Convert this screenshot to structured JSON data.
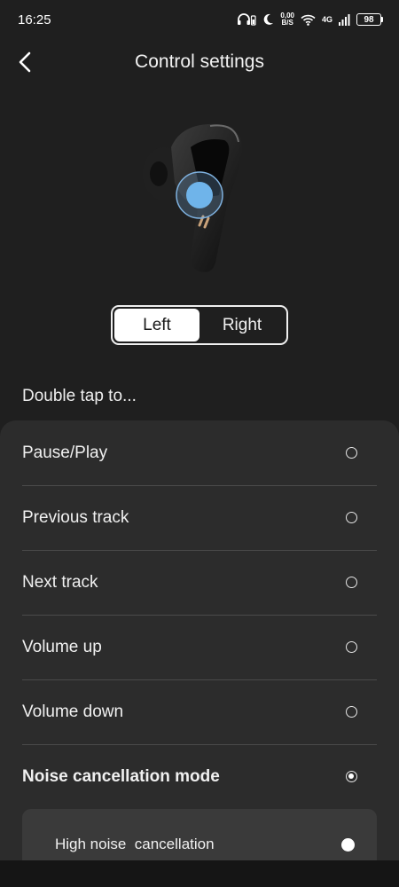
{
  "status_bar": {
    "time": "16:25",
    "speed_value": "0,00",
    "speed_unit": "B/S",
    "network": "4G",
    "battery": "98",
    "icons": [
      "headphones-battery-icon",
      "moon-icon",
      "wifi-icon",
      "signal-icon",
      "battery-icon"
    ]
  },
  "header": {
    "title": "Control settings",
    "back_icon": "chevron-left-icon"
  },
  "side_toggle": {
    "left_label": "Left",
    "right_label": "Right",
    "selected": "Left"
  },
  "section": {
    "label": "Double tap to..."
  },
  "options": [
    {
      "label": "Pause/Play",
      "selected": false
    },
    {
      "label": "Previous track",
      "selected": false
    },
    {
      "label": "Next track",
      "selected": false
    },
    {
      "label": "Volume up",
      "selected": false
    },
    {
      "label": "Volume down",
      "selected": false
    },
    {
      "label": "Noise cancellation mode",
      "selected": true
    }
  ],
  "sub_option": {
    "label": "High noise  cancellation",
    "selected": true
  },
  "colors": {
    "background": "#1f1f1f",
    "panel": "#2c2c2c",
    "sub_panel": "#3a3a3a",
    "tap_highlight": "#6fb4ea"
  }
}
